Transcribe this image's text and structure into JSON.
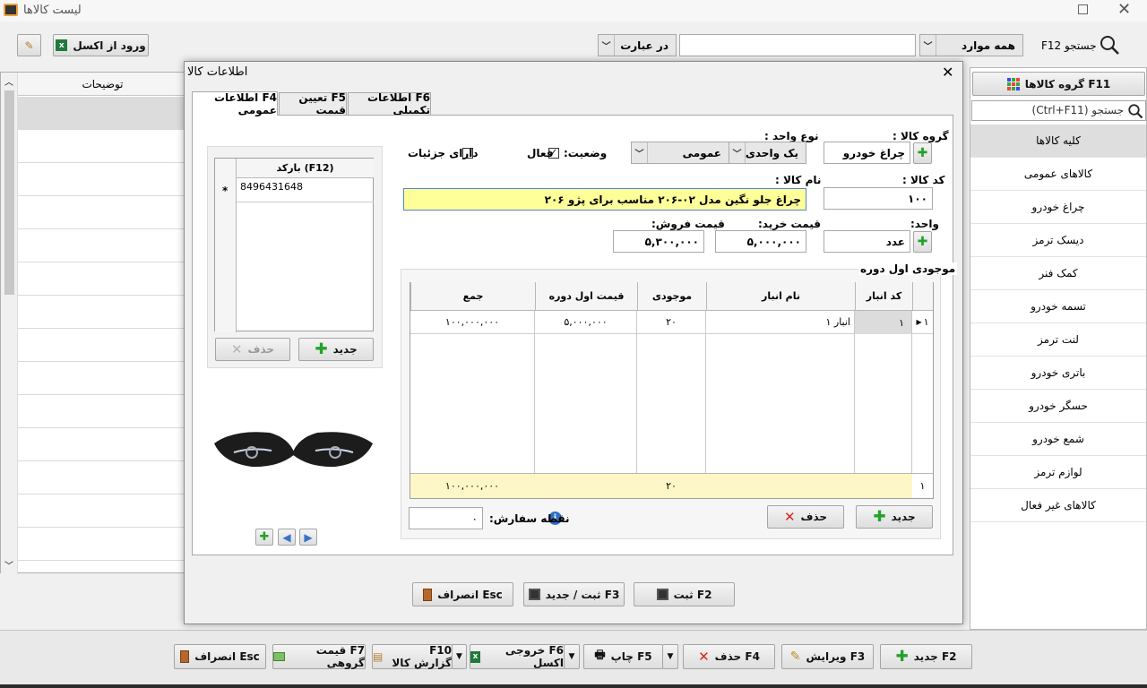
{
  "window": {
    "title": "لیست کالاها"
  },
  "toolbar": {
    "import_excel": "ورود از اکسل",
    "in_phrase": "در عبارت",
    "all_items": "همه موارد",
    "search_label": "جستجو F12",
    "search_value": ""
  },
  "main_table": {
    "col_description": "توضیحات"
  },
  "sidebar": {
    "group_button": "F11 گروه کالاها",
    "search_placeholder": "جستجو (Ctrl+F11)",
    "items": [
      "کلیه کالاها",
      "کالاهای عمومی",
      "چراغ خودرو",
      "دیسک ترمز",
      "کمک فنر",
      "تسمه خودرو",
      "لنت ترمز",
      "باتری خودرو",
      "حسگر خودرو",
      "شمع خودرو",
      "لوازم ترمز",
      "کالاهای غیر فعال"
    ]
  },
  "bottom_bar": {
    "new": "F2 جدید",
    "edit": "F3 ویرایش",
    "delete": "F4 حذف",
    "print": "F5 چاپ",
    "excel_out": "F6 خروجی اکسل",
    "report": "F10 گزارش کالا",
    "group_price": "F7 قیمت گروهی",
    "cancel": "Esc انصراف"
  },
  "dialog": {
    "title": "اطلاعات کالا",
    "tabs": [
      "F4 اطلاعات عمومی",
      "F5 تعیین قیمت",
      "F6 اطلاعات تکمیلی"
    ],
    "group_label": "گروه کالا :",
    "group_value": "چراغ خودرو",
    "unit_type_label": "نوع واحد :",
    "unit_type_value": "یک واحدی",
    "unit_type_value2": "عمومی",
    "status_label": "وضعیت:",
    "active_label": "فعال",
    "details_label": "دارای جزئیات",
    "code_label": "کد کالا :",
    "code_value": "۱۰۰",
    "name_label": "نام کالا :",
    "name_value": "چراغ جلو نگین مدل ۰۲-۲۰۶ مناسب برای پژو ۲۰۶",
    "unit_label": "واحد:",
    "unit_value": "عدد",
    "buy_label": "قیمت خرید:",
    "buy_value": "۵,۰۰۰,۰۰۰",
    "sell_label": "قیمت فروش:",
    "sell_value": "۵,۳۰۰,۰۰۰",
    "barcode_header": "(F12) بارکد",
    "barcode_value": "8496431648",
    "barcode_marker": "*",
    "barcode_new": "جدید",
    "barcode_delete": "حذف",
    "stock_title": "موجودی اول دوره",
    "stock_headers": {
      "code": "کد انبار",
      "name": "نام انبار",
      "qty": "موجودی",
      "price": "قیمت اول دوره",
      "total": "جمع"
    },
    "stock_row": {
      "index": "۱",
      "code": "۱",
      "name": "انبار ۱",
      "qty": "۲۰",
      "price": "۵,۰۰۰,۰۰۰",
      "total": "۱۰۰,۰۰۰,۰۰۰"
    },
    "stock_footer": {
      "index": "۱",
      "qty": "۲۰",
      "total": "۱۰۰,۰۰۰,۰۰۰"
    },
    "stock_new": "جدید",
    "stock_delete": "حذف",
    "reorder_label": "نقطه سفارش:",
    "reorder_value": "۰",
    "save": "F2 ثبت",
    "save_new": "F3 ثبت / جدید",
    "cancel": "Esc انصراف"
  }
}
